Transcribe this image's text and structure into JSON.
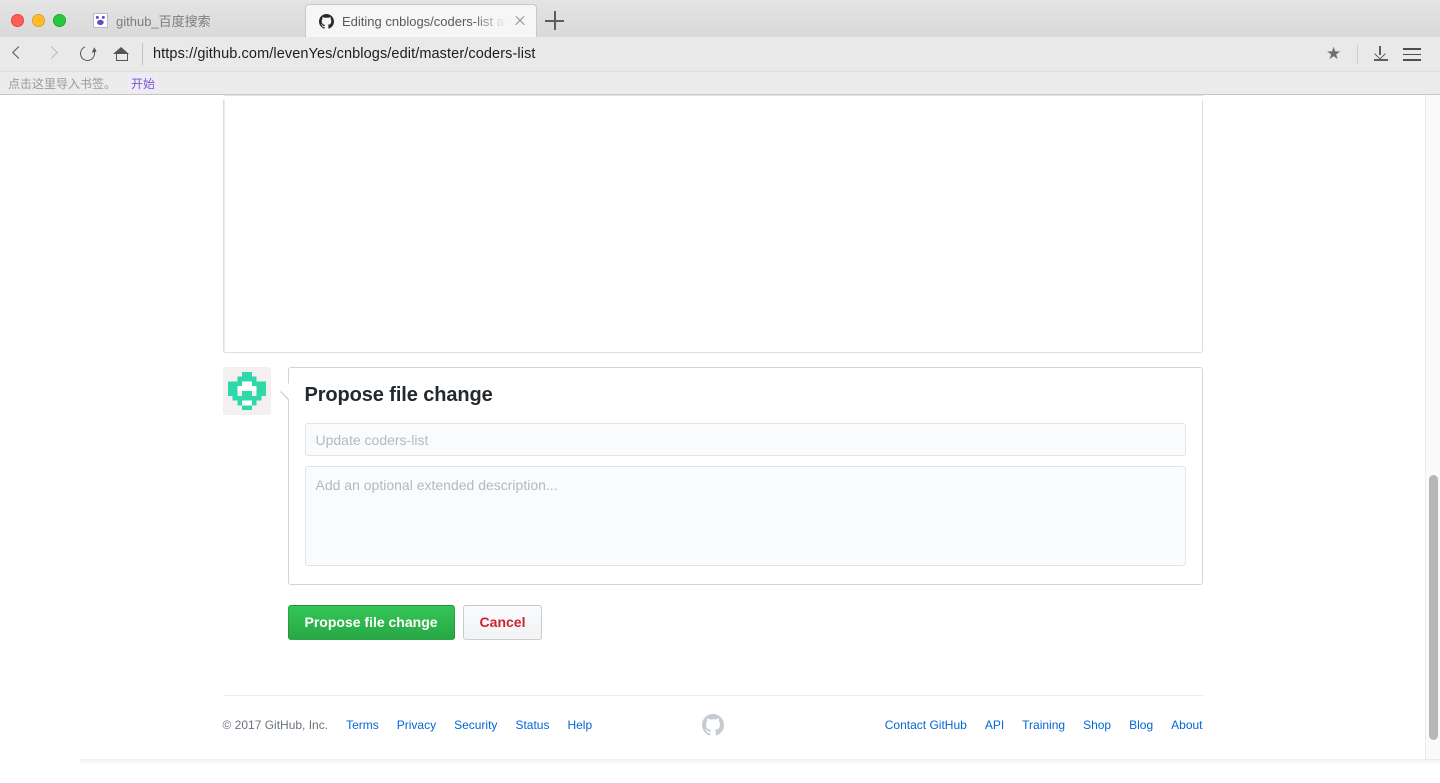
{
  "browser": {
    "tabs": [
      {
        "title": "github_百度搜索",
        "favicon": "baidu-icon",
        "active": false
      },
      {
        "title": "Editing cnblogs/coders-list at",
        "favicon": "github-icon",
        "active": true
      }
    ],
    "new_tab_label": "+",
    "url": "https://github.com/levenYes/cnblogs/edit/master/coders-list",
    "nav": {
      "back": "back-icon",
      "forward": "forward-icon",
      "reload": "reload-icon",
      "home": "home-icon"
    },
    "actions": {
      "bookmark": "★",
      "download": "download-icon",
      "menu": "menu-icon"
    },
    "bookmarks_bar": {
      "hint": "点击这里导入书签。",
      "start_link": "开始"
    }
  },
  "commit_form": {
    "avatar_alt": "user-avatar-identicon",
    "title": "Propose file change",
    "summary": {
      "value": "",
      "placeholder": "Update coders-list"
    },
    "description": {
      "value": "",
      "placeholder": "Add an optional extended description..."
    },
    "submit_label": "Propose file change",
    "cancel_label": "Cancel"
  },
  "footer": {
    "copyright": "© 2017 GitHub, Inc.",
    "left_links": [
      "Terms",
      "Privacy",
      "Security",
      "Status",
      "Help"
    ],
    "mark": "github-octocat-mark",
    "right_links": [
      "Contact GitHub",
      "API",
      "Training",
      "Shop",
      "Blog",
      "About"
    ]
  },
  "colors": {
    "green_button": "#28a745",
    "cancel_red": "#cb2431",
    "link_blue": "#0366d6",
    "avatar_teal": "#2fd8a8",
    "chrome_grey": "#e8e8e8"
  }
}
